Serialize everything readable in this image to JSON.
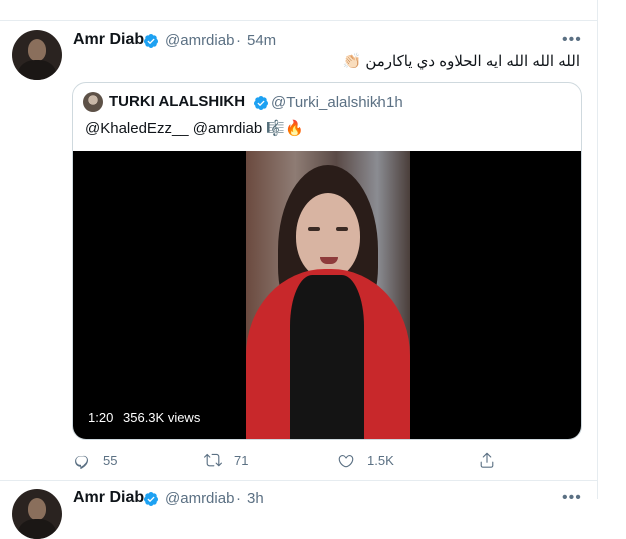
{
  "tweet": {
    "author_name": "Amr Diab",
    "author_handle": "@amrdiab",
    "separator": "·",
    "time": "54m",
    "text": "الله الله الله ايه الحلاوه دي ياكارمن",
    "text_emoji": "👏🏻",
    "more_label": "•••",
    "icons": {
      "avatar": "amr-diab-avatar",
      "verified": "verified-badge-icon",
      "more": "more-icon"
    }
  },
  "quote": {
    "author_name": "TURKI ALALSHIKH",
    "author_handle": "@Turki_alalshikh",
    "separator": "·",
    "time": "1h",
    "text": "@KhaledEzz__ @amrdiab 🎼🔥",
    "video": {
      "duration": "1:20",
      "views": "356.3K views"
    }
  },
  "actions": {
    "reply_count": "55",
    "retweet_count": "71",
    "like_count": "1.5K",
    "icons": [
      "reply-icon",
      "retweet-icon",
      "like-icon",
      "share-icon"
    ]
  },
  "next_tweet": {
    "author_name": "Amr Diab",
    "author_handle": "@amrdiab",
    "separator": "·",
    "time": "3h",
    "more_label": "•••"
  },
  "colors": {
    "verified": "#1da1f2",
    "secondary_text": "#5b7083",
    "border": "#cfd9de",
    "divider": "#e6ecf0"
  }
}
